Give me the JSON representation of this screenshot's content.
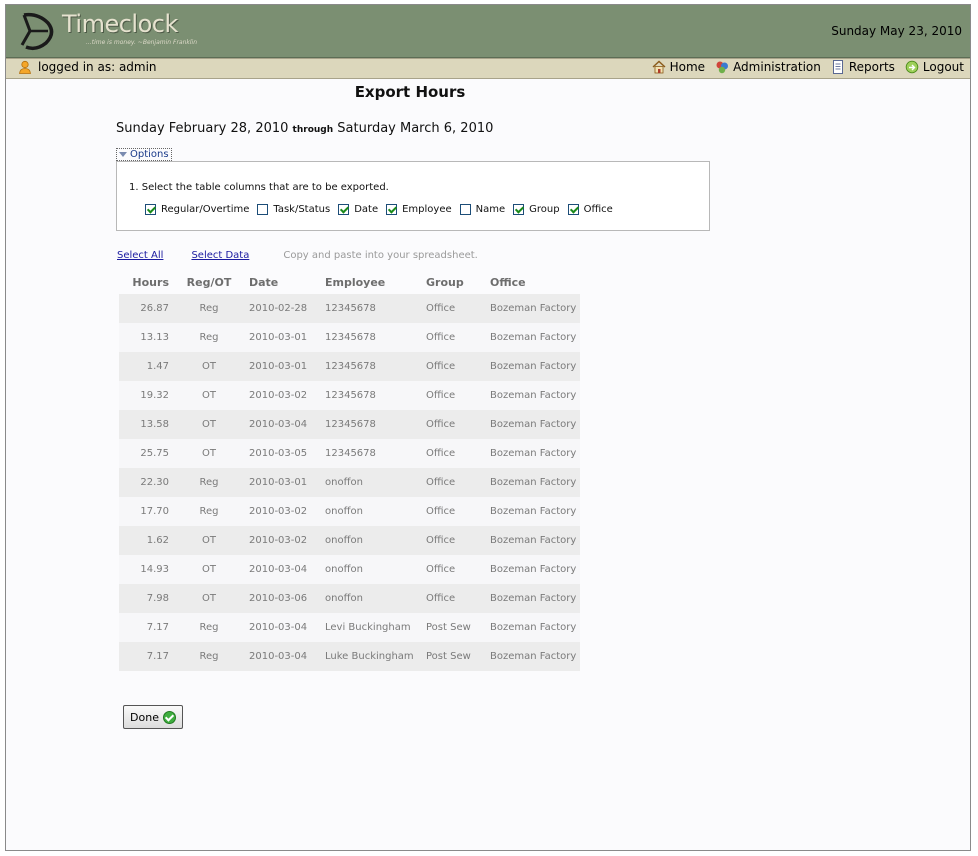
{
  "header": {
    "logo_text": "Timeclock",
    "tagline": "...time is money.  ~Benjamin Franklin",
    "date": "Sunday May 23, 2010"
  },
  "navbar": {
    "logged_in": "logged in as: admin",
    "links": [
      {
        "label": "Home",
        "icon": "home-icon"
      },
      {
        "label": "Administration",
        "icon": "administration-icon"
      },
      {
        "label": "Reports",
        "icon": "reports-icon"
      },
      {
        "label": "Logout",
        "icon": "logout-icon"
      }
    ]
  },
  "page": {
    "title": "Export Hours",
    "range_start": "Sunday February 28, 2010",
    "range_through": "through",
    "range_end": "Saturday March 6, 2010"
  },
  "options": {
    "toggle_label": "Options",
    "instruction": "1.   Select the table columns that are to be exported.",
    "columns": [
      {
        "label": "Regular/Overtime",
        "checked": true
      },
      {
        "label": "Task/Status",
        "checked": false
      },
      {
        "label": "Date",
        "checked": true
      },
      {
        "label": "Employee",
        "checked": true
      },
      {
        "label": "Name",
        "checked": false
      },
      {
        "label": "Group",
        "checked": true
      },
      {
        "label": "Office",
        "checked": true
      }
    ]
  },
  "actions": {
    "select_all": "Select All",
    "select_data": "Select Data",
    "hint": "Copy and paste into your spreadsheet."
  },
  "table": {
    "headers": [
      "Hours",
      "Reg/OT",
      "Date",
      "Employee",
      "Group",
      "Office"
    ],
    "rows": [
      [
        "26.87",
        "Reg",
        "2010-02-28",
        "12345678",
        "Office",
        "Bozeman Factory"
      ],
      [
        "13.13",
        "Reg",
        "2010-03-01",
        "12345678",
        "Office",
        "Bozeman Factory"
      ],
      [
        "1.47",
        "OT",
        "2010-03-01",
        "12345678",
        "Office",
        "Bozeman Factory"
      ],
      [
        "19.32",
        "OT",
        "2010-03-02",
        "12345678",
        "Office",
        "Bozeman Factory"
      ],
      [
        "13.58",
        "OT",
        "2010-03-04",
        "12345678",
        "Office",
        "Bozeman Factory"
      ],
      [
        "25.75",
        "OT",
        "2010-03-05",
        "12345678",
        "Office",
        "Bozeman Factory"
      ],
      [
        "22.30",
        "Reg",
        "2010-03-01",
        "onoffon",
        "Office",
        "Bozeman Factory"
      ],
      [
        "17.70",
        "Reg",
        "2010-03-02",
        "onoffon",
        "Office",
        "Bozeman Factory"
      ],
      [
        "1.62",
        "OT",
        "2010-03-02",
        "onoffon",
        "Office",
        "Bozeman Factory"
      ],
      [
        "14.93",
        "OT",
        "2010-03-04",
        "onoffon",
        "Office",
        "Bozeman Factory"
      ],
      [
        "7.98",
        "OT",
        "2010-03-06",
        "onoffon",
        "Office",
        "Bozeman Factory"
      ],
      [
        "7.17",
        "Reg",
        "2010-03-04",
        "Levi Buckingham",
        "Post Sew",
        "Bozeman Factory"
      ],
      [
        "7.17",
        "Reg",
        "2010-03-04",
        "Luke Buckingham",
        "Post Sew",
        "Bozeman Factory"
      ]
    ]
  },
  "done_button": {
    "label": "Done",
    "icon": "check-circle-icon"
  },
  "colors": {
    "header_bg": "#7b8f72",
    "navbar_bg": "#dcd7bc",
    "row_odd": "#ececec",
    "row_even": "#f7f7f9"
  }
}
